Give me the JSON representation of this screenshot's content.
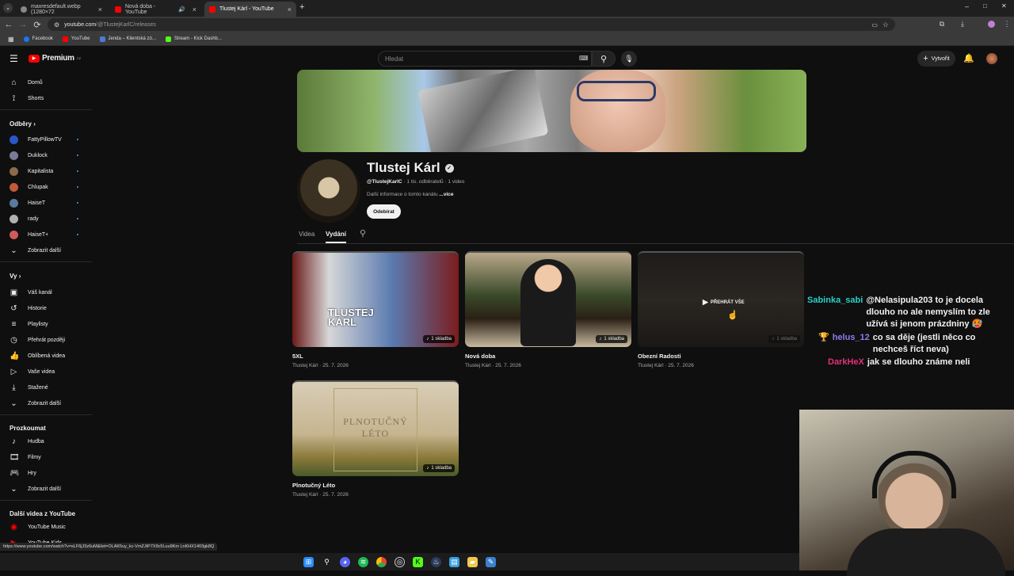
{
  "browser": {
    "tabs": [
      {
        "title": "maxresdefault.webp (1280×72",
        "active": false
      },
      {
        "title": "Nová doba - YouTube",
        "active": false
      },
      {
        "title": "Tlustej Kárl - YouTube",
        "active": true
      }
    ],
    "new_tab_icon": "+",
    "url_host": "youtube.com",
    "url_path": "/@TlustejKarlC/releases",
    "bookmarks": [
      "Facebook",
      "YouTube",
      "Jenda – Klientská zó...",
      "Stream - Kick Dashb..."
    ],
    "window_controls": [
      "–",
      "□",
      "✕"
    ]
  },
  "yt": {
    "logo_text": "Premium",
    "logo_sup": "CZ",
    "search_placeholder": "Hledat",
    "create_label": "Vytvořit"
  },
  "sidebar": {
    "top": [
      {
        "label": "Domů",
        "icon": "home-icon"
      },
      {
        "label": "Shorts",
        "icon": "shorts-icon"
      }
    ],
    "subs_header": "Odběry",
    "subs": [
      "FattyPillowTV",
      "Duklock",
      "Kapitalista",
      "Chlupak",
      "HaiseT",
      "rady",
      "HaiseT+"
    ],
    "subs_more": "Zobrazit další",
    "you_header": "Vy",
    "you": [
      {
        "label": "Váš kanál",
        "icon": "channel-icon"
      },
      {
        "label": "Historie",
        "icon": "history-icon"
      },
      {
        "label": "Playlisty",
        "icon": "playlist-icon"
      },
      {
        "label": "Přehrát později",
        "icon": "clock-icon"
      },
      {
        "label": "Oblíbená videa",
        "icon": "like-icon"
      },
      {
        "label": "Vaše videa",
        "icon": "video-icon"
      },
      {
        "label": "Stažené",
        "icon": "download-icon"
      },
      {
        "label": "Zobrazit další",
        "icon": "chevron-down-icon"
      }
    ],
    "explore_header": "Prozkoumat",
    "explore": [
      {
        "label": "Hudba",
        "icon": "music-icon"
      },
      {
        "label": "Filmy",
        "icon": "film-icon"
      },
      {
        "label": "Hry",
        "icon": "gamepad-icon"
      },
      {
        "label": "Zobrazit další",
        "icon": "chevron-down-icon"
      }
    ],
    "more_header": "Další videa z YouTube",
    "more": [
      "YouTube Music",
      "YouTube Kids"
    ]
  },
  "channel": {
    "name": "Tlustej Kárl",
    "handle": "@TlustejKarlC",
    "stats": " · 1 tis. odběratelů · 1 video",
    "about": "Další informace o tomto kanálu",
    "about_more": " ...více",
    "subscribe": "Odebírat",
    "tabs": [
      "Videa",
      "Vydání"
    ]
  },
  "releases": [
    {
      "title": "5XL",
      "sub": "Tlustej Kárl · 25. 7. 2026",
      "badge": "1 skladba",
      "overlay": ""
    },
    {
      "title": "Nová doba",
      "sub": "Tlustej Kárl · 25. 7. 2026",
      "badge": "1 skladba",
      "overlay": ""
    },
    {
      "title": "Obezní Radosti",
      "sub": "Tlustej Kárl · 25. 7. 2026",
      "badge": "1 skladba",
      "overlay": "PŘEHRÁT VŠE"
    },
    {
      "title": "Plnotučný Léto",
      "sub": "Tlustej Kárl · 25. 7. 2026",
      "badge": "1 skladba",
      "overlay": ""
    }
  ],
  "chat": [
    {
      "user": "Sabinka_sabi",
      "color": "#2ad0c8",
      "text": "@Nelasipula203 to je docela dlouho no ale nemyslím to zle užívá si jenom prázdniny 🥵",
      "mention": "@Nelasipula203"
    },
    {
      "user": "helus_12",
      "color": "#8a7cf0",
      "text": "co sa děje (jestli něco co nechceš říct neva)",
      "prefix": "🏆"
    },
    {
      "user": "DarkHeX",
      "color": "#e0307a",
      "text": "jak se dlouho známe neli"
    }
  ],
  "status_url": "https://www.youtube.com/watch?v=sLF6jJ3z6uM&list=OLAK5uy_kc-VmZJtP7X9c5Luu9Km LnKHX1403gk8Q"
}
